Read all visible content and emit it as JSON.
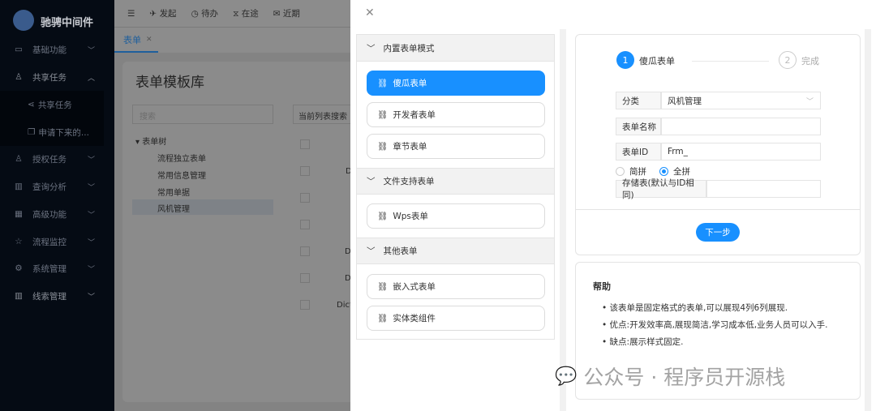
{
  "sidebar": {
    "brand": "驰骋中间件",
    "items": [
      {
        "label": "基础功能",
        "icon": "folder-icon"
      },
      {
        "label": "共享任务",
        "icon": "user-share-icon"
      },
      {
        "label": "授权任务",
        "icon": "users-icon"
      },
      {
        "label": "查询分析",
        "icon": "bar-chart-icon"
      },
      {
        "label": "高级功能",
        "icon": "grid-icon"
      },
      {
        "label": "流程监控",
        "icon": "star-icon"
      },
      {
        "label": "系统管理",
        "icon": "gear-icon"
      },
      {
        "label": "线索管理",
        "icon": "bar-chart-icon"
      }
    ],
    "subitems": [
      {
        "label": "共享任务"
      },
      {
        "label": "申请下来的..."
      }
    ]
  },
  "topbar": {
    "items": [
      "发起",
      "待办",
      "在途",
      "近期"
    ]
  },
  "tabs": [
    {
      "label": "表单"
    }
  ],
  "page": {
    "title": "表单模板库",
    "search_placeholder": "搜索",
    "list_search": "当前列表搜索",
    "tree": {
      "root": "表单树",
      "children": [
        "流程独立表单",
        "常用信息管理",
        "常用单据",
        "风机管理"
      ]
    },
    "rows": [
      "",
      "D",
      "",
      "",
      "D",
      "D",
      "Dict"
    ]
  },
  "drawer": {
    "sections": [
      {
        "title": "内置表单模式",
        "items": [
          "傻瓜表单",
          "开发者表单",
          "章节表单"
        ]
      },
      {
        "title": "文件支持表单",
        "items": [
          "Wps表单"
        ]
      },
      {
        "title": "其他表单",
        "items": [
          "嵌入式表单",
          "实体类组件"
        ]
      }
    ],
    "steps": [
      {
        "num": "1",
        "label": "傻瓜表单"
      },
      {
        "num": "2",
        "label": "完成"
      }
    ],
    "form": {
      "category_label": "分类",
      "category_value": "风机管理",
      "name_label": "表单名称",
      "name_value": "",
      "id_label": "表单ID",
      "id_value": "Frm_",
      "radio1": "简拼",
      "radio2": "全拼",
      "storage_label": "存储表(默认与ID相同)",
      "storage_value": "",
      "next": "下一步"
    },
    "help": {
      "title": "帮助",
      "items": [
        "该表单是固定格式的表单,可以展现4列6列展现.",
        "优点:开发效率高,展现简洁,学习成本低,业务人员可以入手.",
        "缺点:展示样式固定."
      ]
    }
  },
  "watermark": "公众号 · 程序员开源栈",
  "colors": {
    "accent": "#1890ff",
    "sidebar": "#050b14"
  }
}
